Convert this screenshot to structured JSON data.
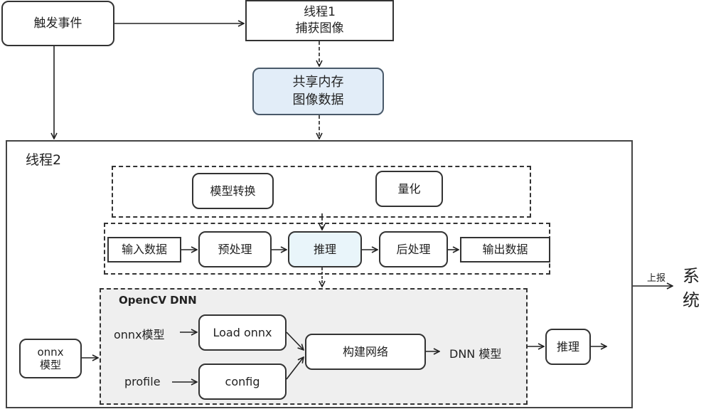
{
  "nodes": {
    "trigger_event": "触发事件",
    "thread1_line1": "线程1",
    "thread1_line2": "捕获图像",
    "shared_mem_line1": "共享内存",
    "shared_mem_line2": "图像数据",
    "thread2_title": "线程2",
    "model_convert": "模型转换",
    "quantize": "量化",
    "input_data": "输入数据",
    "preprocess": "预处理",
    "inference": "推理",
    "postprocess": "后处理",
    "output_data": "输出数据",
    "opencv_dnn_title": "OpenCV DNN",
    "onnx_model_label": "onnx模型",
    "load_onnx": "Load onnx",
    "profile_label": "profile",
    "config": "config",
    "build_network": "构建网络",
    "dnn_model_label": "DNN 模型",
    "onnx_model_box_line1": "onnx",
    "onnx_model_box_line2": "模型",
    "inference2": "推理",
    "report_label": "上报",
    "system_line1": "系",
    "system_line2": "统"
  },
  "colors": {
    "shared_memory_fill": "#e2edf8",
    "inference_fill": "#e9f5fa",
    "opencv_region_fill": "#efefef"
  }
}
